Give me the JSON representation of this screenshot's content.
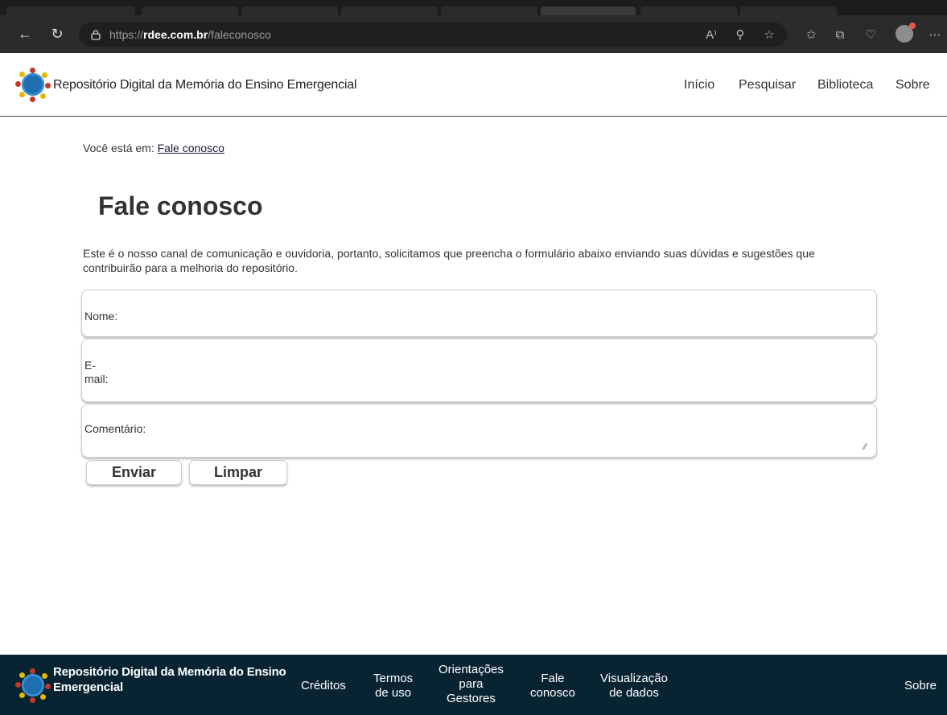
{
  "browser": {
    "url_protocol": "https://",
    "url_domain": "rdee.com.br",
    "url_path": "/faleconosco",
    "icons": [
      "back-arrow-icon",
      "refresh-icon",
      "lock-icon",
      "read-aloud-icon",
      "zoom-icon",
      "favorite-star-icon",
      "favorites-icon",
      "collections-icon",
      "browser-essentials-icon",
      "profile-avatar",
      "more-icon"
    ]
  },
  "header": {
    "brand": "Repositório Digital da Memória do Ensino Emergencial",
    "nav": [
      "Início",
      "Pesquisar",
      "Biblioteca",
      "Sobre"
    ]
  },
  "breadcrumb": {
    "prefix": "Você está em:",
    "current": "Fale conosco"
  },
  "page": {
    "title": "Fale conosco",
    "intro": "Este é o nosso canal de comunicação e ouvidoria, portanto, solicitamos que preencha o formulário abaixo enviando suas dúvidas e sugestões que contribuirão para a melhoria do repositório."
  },
  "form": {
    "name_label": "Nome:",
    "name_value": "",
    "email_label_line1": "E-",
    "email_label_line2": "mail:",
    "email_value": "",
    "comment_label": "Comentário:",
    "comment_value": "",
    "submit_label": "Enviar",
    "reset_label": "Limpar"
  },
  "footer": {
    "brand_line1": "Repositório Digital da Memória do Ensino",
    "brand_line2": "Emergencial",
    "links": {
      "creditos": "Créditos",
      "termos_1": "Termos",
      "termos_2": "de uso",
      "orient_1": "Orientações",
      "orient_2": "para",
      "orient_3": "Gestores",
      "fale_1": "Fale",
      "fale_2": "conosco",
      "visual_1": "Visualização",
      "visual_2": "de dados",
      "sobre": "Sobre"
    }
  },
  "colors": {
    "browser_bg": "#2b2b2b",
    "footer_bg": "#082433",
    "text": "#333333"
  }
}
